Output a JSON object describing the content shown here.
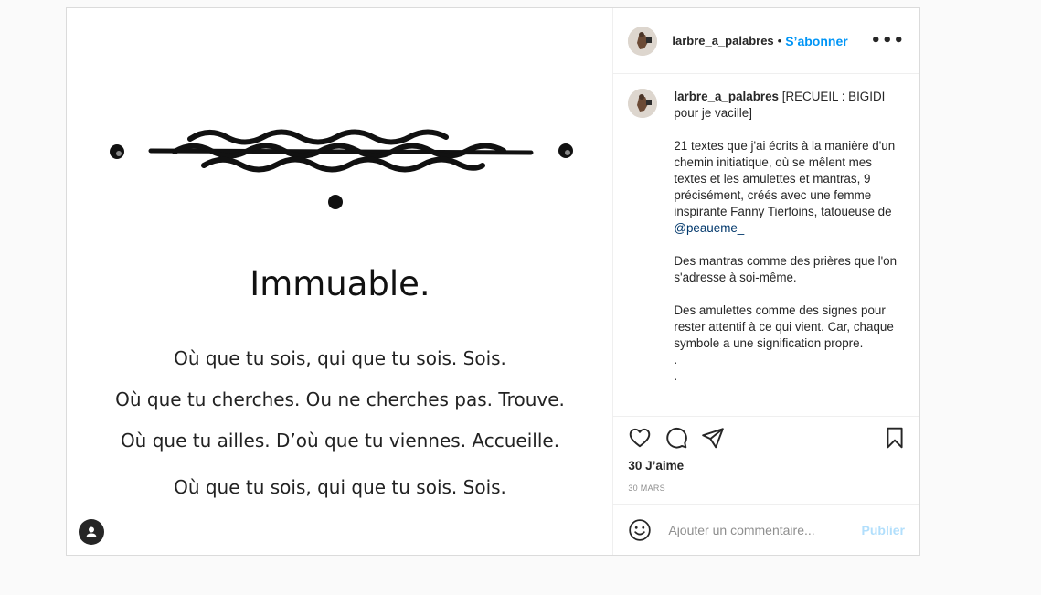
{
  "post": {
    "image": {
      "title": "Immuable.",
      "lines": [
        "Où que tu sois, qui que tu sois. Sois.",
        "Où que tu cherches. Ou ne cherches pas. Trouve.",
        "Où que tu ailles. D’où que tu viennes. Accueille.",
        "Où que tu sois, qui que tu sois. Sois."
      ],
      "tag_icon": "user-tag-icon"
    },
    "header": {
      "username": "larbre_a_palabres",
      "separator": "•",
      "follow_label": "S’abonner",
      "more_label": "•••"
    },
    "caption": {
      "username": "larbre_a_palabres",
      "first_line": "[RECUEIL : BIGIDI pour je vacille]",
      "para1": "21 textes que j'ai écrits à la manière d'un chemin initiatique, où se mêlent mes textes et les amulettes et mantras, 9 précisément, créés avec une femme inspirante Fanny Tierfoins, tatoueuse de",
      "mention": "@peaueme_",
      "para2": "Des mantras comme des prières que l'on s'adresse à soi-même.",
      "para3": "Des amulettes comme des signes pour rester attentif à ce qui vient. Car, chaque symbole a une signification propre.",
      "dot1": ".",
      "dot2": "."
    },
    "actions": {
      "likes": "30 J’aime",
      "date": "30 MARS",
      "icons": [
        "heart-icon",
        "comment-icon",
        "share-icon",
        "bookmark-icon"
      ]
    },
    "comment": {
      "placeholder": "Ajouter un commentaire...",
      "publish_label": "Publier",
      "emoji_icon": "emoji-icon"
    }
  },
  "colors": {
    "accent": "#0095f6",
    "publish_disabled": "#b2dffc",
    "text": "#262626",
    "muted": "#8e8e8e",
    "border": "#dbdbdb",
    "page_bg": "#fafafa"
  }
}
